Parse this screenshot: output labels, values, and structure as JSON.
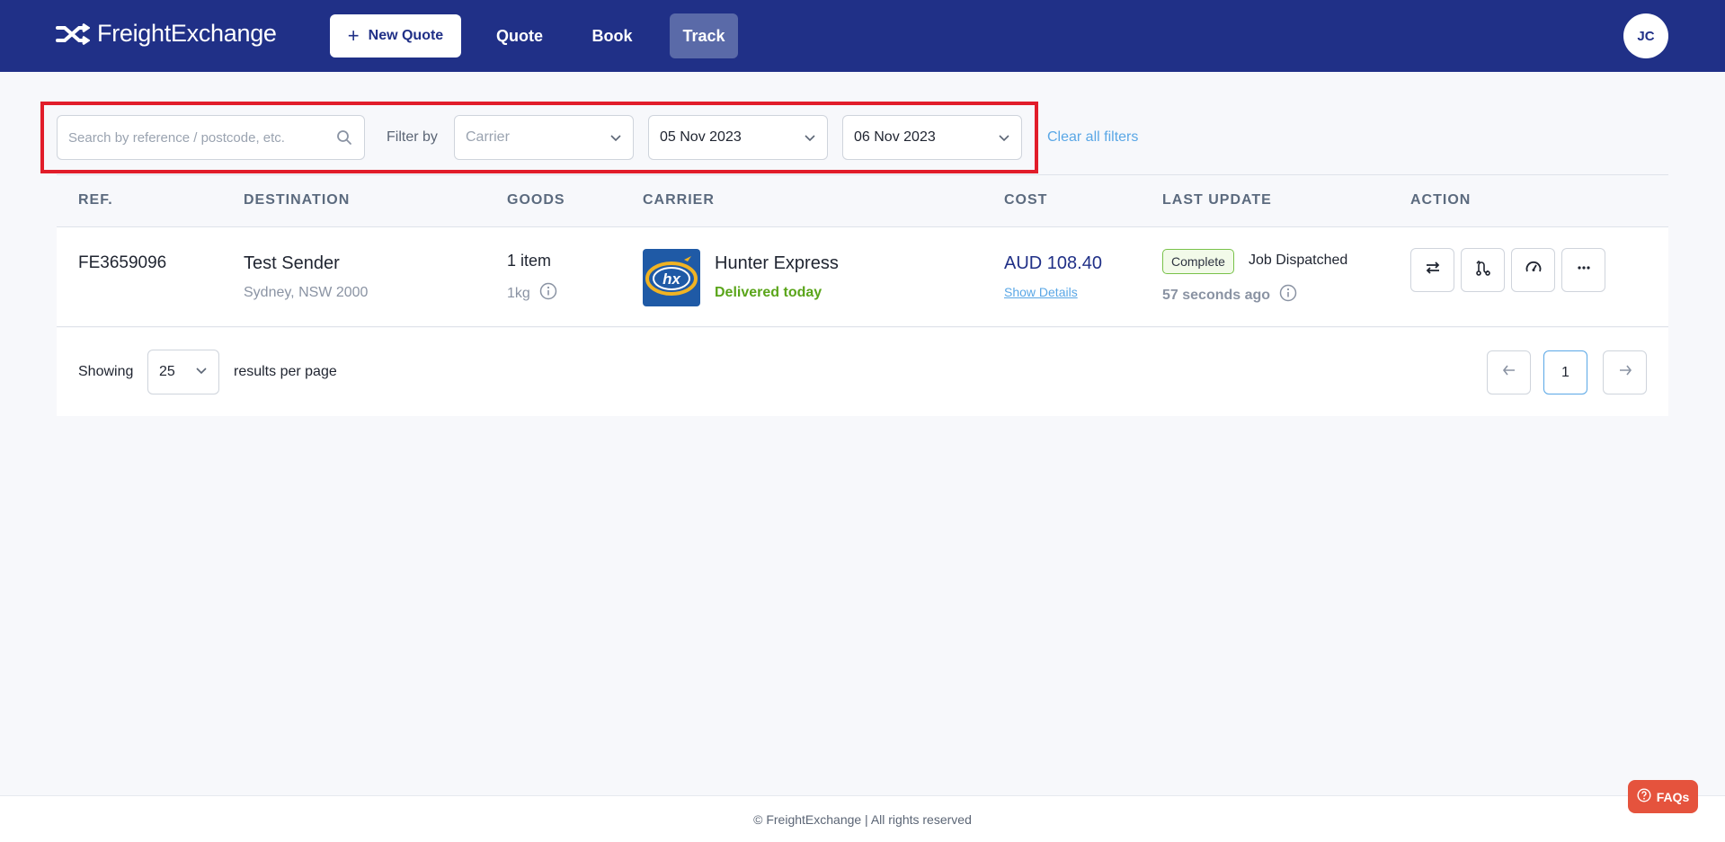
{
  "header": {
    "brand": "FreightExchange",
    "new_quote_label": "New Quote",
    "nav": {
      "quote": "Quote",
      "book": "Book",
      "track": "Track"
    },
    "active_nav": "Track",
    "user_initials": "JC",
    "bg_color": "#203087"
  },
  "filters": {
    "search_placeholder": "Search by reference / postcode, etc.",
    "filter_by_label": "Filter by",
    "carrier_placeholder": "Carrier",
    "date_from": "05 Nov 2023",
    "date_to": "06 Nov 2023",
    "clear_label": "Clear all filters"
  },
  "table": {
    "headers": {
      "ref": "REF.",
      "destination": "DESTINATION",
      "goods": "GOODS",
      "carrier": "CARRIER",
      "cost": "COST",
      "last_update": "LAST UPDATE",
      "action": "ACTION"
    },
    "rows": [
      {
        "ref": "FE3659096",
        "destination_name": "Test Sender",
        "destination_sub": "Sydney, NSW 2000",
        "goods": "1 item",
        "weight": "1kg",
        "carrier_name": "Hunter Express",
        "carrier_status": "Delivered today",
        "cost": "AUD 108.40",
        "show_details": "Show Details",
        "status_badge": "Complete",
        "last_update": "Job Dispatched",
        "time_ago": "57 seconds ago",
        "actions": [
          "repeat-icon",
          "route-icon",
          "speedometer-icon",
          "more-icon"
        ]
      }
    ]
  },
  "pagination": {
    "showing_label": "Showing",
    "per_page": "25",
    "per_page_label": "results per page",
    "current_page": "1"
  },
  "footer": {
    "copyright": "© FreightExchange | All rights reserved"
  },
  "faq_label": "FAQs"
}
